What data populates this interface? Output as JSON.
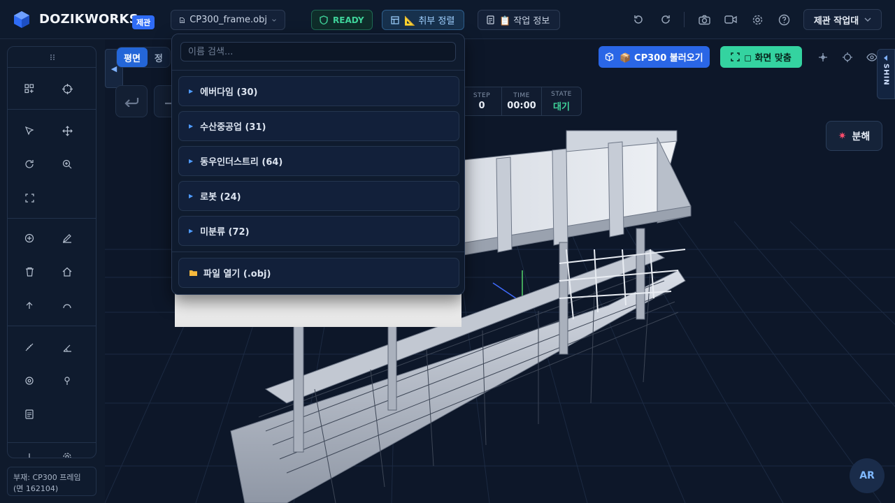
{
  "header": {
    "brand": "DOZIKWORKS",
    "brand_badge": "제관",
    "file_name": "CP300_frame.obj",
    "status": "READY",
    "align_label": "📐 취부 정렬",
    "info_label": "📋 작업 정보",
    "workspace": "제관 작업대"
  },
  "status_panel": {
    "line1": "부재: CP300 프레임",
    "line2": "(면 162104)"
  },
  "viewport": {
    "view_tabs": [
      "평면",
      "정"
    ],
    "hud": [
      {
        "label": "STEP",
        "value": "0"
      },
      {
        "label": "TIME",
        "value": "00:00"
      },
      {
        "label": "STATE",
        "value": "대기"
      }
    ],
    "load_label": "📦 CP300 불러오기",
    "fit_label": "◻ 화면 맞춤",
    "side_tab_label": "SHIN",
    "explode_label": "분해",
    "ar_label": "AR"
  },
  "dropdown": {
    "search_placeholder": "이름 검색...",
    "groups": [
      {
        "name": "에버다임 (30)"
      },
      {
        "name": "수산중공업 (31)"
      },
      {
        "name": "동우인더스트리 (64)"
      },
      {
        "name": "로봇 (24)"
      },
      {
        "name": "미분류 (72)"
      }
    ],
    "open_file_label": "파일 열기 (.obj)"
  },
  "colors": {
    "primary": "#2a66e6",
    "success": "#34d3a0",
    "background": "#0f1a2c"
  }
}
